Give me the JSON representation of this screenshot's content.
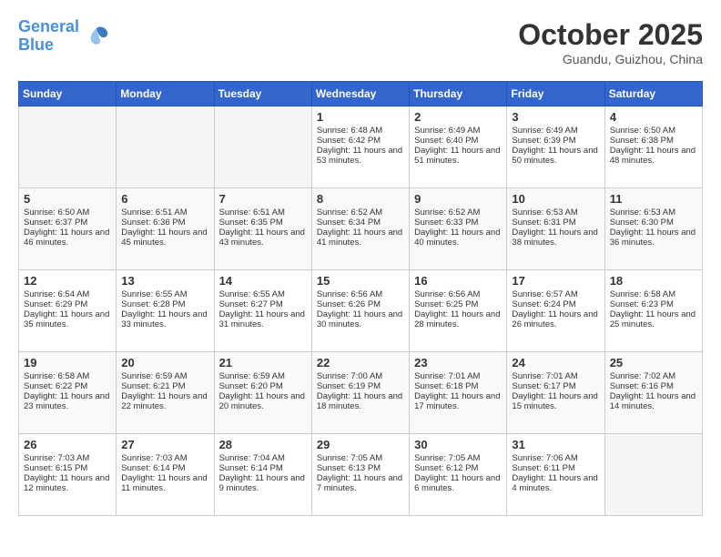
{
  "header": {
    "logo_line1": "General",
    "logo_line2": "Blue",
    "month": "October 2025",
    "location": "Guandu, Guizhou, China"
  },
  "weekdays": [
    "Sunday",
    "Monday",
    "Tuesday",
    "Wednesday",
    "Thursday",
    "Friday",
    "Saturday"
  ],
  "weeks": [
    [
      {
        "day": "",
        "info": ""
      },
      {
        "day": "",
        "info": ""
      },
      {
        "day": "",
        "info": ""
      },
      {
        "day": "1",
        "info": "Sunrise: 6:48 AM\nSunset: 6:42 PM\nDaylight: 11 hours and 53 minutes."
      },
      {
        "day": "2",
        "info": "Sunrise: 6:49 AM\nSunset: 6:40 PM\nDaylight: 11 hours and 51 minutes."
      },
      {
        "day": "3",
        "info": "Sunrise: 6:49 AM\nSunset: 6:39 PM\nDaylight: 11 hours and 50 minutes."
      },
      {
        "day": "4",
        "info": "Sunrise: 6:50 AM\nSunset: 6:38 PM\nDaylight: 11 hours and 48 minutes."
      }
    ],
    [
      {
        "day": "5",
        "info": "Sunrise: 6:50 AM\nSunset: 6:37 PM\nDaylight: 11 hours and 46 minutes."
      },
      {
        "day": "6",
        "info": "Sunrise: 6:51 AM\nSunset: 6:36 PM\nDaylight: 11 hours and 45 minutes."
      },
      {
        "day": "7",
        "info": "Sunrise: 6:51 AM\nSunset: 6:35 PM\nDaylight: 11 hours and 43 minutes."
      },
      {
        "day": "8",
        "info": "Sunrise: 6:52 AM\nSunset: 6:34 PM\nDaylight: 11 hours and 41 minutes."
      },
      {
        "day": "9",
        "info": "Sunrise: 6:52 AM\nSunset: 6:33 PM\nDaylight: 11 hours and 40 minutes."
      },
      {
        "day": "10",
        "info": "Sunrise: 6:53 AM\nSunset: 6:31 PM\nDaylight: 11 hours and 38 minutes."
      },
      {
        "day": "11",
        "info": "Sunrise: 6:53 AM\nSunset: 6:30 PM\nDaylight: 11 hours and 36 minutes."
      }
    ],
    [
      {
        "day": "12",
        "info": "Sunrise: 6:54 AM\nSunset: 6:29 PM\nDaylight: 11 hours and 35 minutes."
      },
      {
        "day": "13",
        "info": "Sunrise: 6:55 AM\nSunset: 6:28 PM\nDaylight: 11 hours and 33 minutes."
      },
      {
        "day": "14",
        "info": "Sunrise: 6:55 AM\nSunset: 6:27 PM\nDaylight: 11 hours and 31 minutes."
      },
      {
        "day": "15",
        "info": "Sunrise: 6:56 AM\nSunset: 6:26 PM\nDaylight: 11 hours and 30 minutes."
      },
      {
        "day": "16",
        "info": "Sunrise: 6:56 AM\nSunset: 6:25 PM\nDaylight: 11 hours and 28 minutes."
      },
      {
        "day": "17",
        "info": "Sunrise: 6:57 AM\nSunset: 6:24 PM\nDaylight: 11 hours and 26 minutes."
      },
      {
        "day": "18",
        "info": "Sunrise: 6:58 AM\nSunset: 6:23 PM\nDaylight: 11 hours and 25 minutes."
      }
    ],
    [
      {
        "day": "19",
        "info": "Sunrise: 6:58 AM\nSunset: 6:22 PM\nDaylight: 11 hours and 23 minutes."
      },
      {
        "day": "20",
        "info": "Sunrise: 6:59 AM\nSunset: 6:21 PM\nDaylight: 11 hours and 22 minutes."
      },
      {
        "day": "21",
        "info": "Sunrise: 6:59 AM\nSunset: 6:20 PM\nDaylight: 11 hours and 20 minutes."
      },
      {
        "day": "22",
        "info": "Sunrise: 7:00 AM\nSunset: 6:19 PM\nDaylight: 11 hours and 18 minutes."
      },
      {
        "day": "23",
        "info": "Sunrise: 7:01 AM\nSunset: 6:18 PM\nDaylight: 11 hours and 17 minutes."
      },
      {
        "day": "24",
        "info": "Sunrise: 7:01 AM\nSunset: 6:17 PM\nDaylight: 11 hours and 15 minutes."
      },
      {
        "day": "25",
        "info": "Sunrise: 7:02 AM\nSunset: 6:16 PM\nDaylight: 11 hours and 14 minutes."
      }
    ],
    [
      {
        "day": "26",
        "info": "Sunrise: 7:03 AM\nSunset: 6:15 PM\nDaylight: 11 hours and 12 minutes."
      },
      {
        "day": "27",
        "info": "Sunrise: 7:03 AM\nSunset: 6:14 PM\nDaylight: 11 hours and 11 minutes."
      },
      {
        "day": "28",
        "info": "Sunrise: 7:04 AM\nSunset: 6:14 PM\nDaylight: 11 hours and 9 minutes."
      },
      {
        "day": "29",
        "info": "Sunrise: 7:05 AM\nSunset: 6:13 PM\nDaylight: 11 hours and 7 minutes."
      },
      {
        "day": "30",
        "info": "Sunrise: 7:05 AM\nSunset: 6:12 PM\nDaylight: 11 hours and 6 minutes."
      },
      {
        "day": "31",
        "info": "Sunrise: 7:06 AM\nSunset: 6:11 PM\nDaylight: 11 hours and 4 minutes."
      },
      {
        "day": "",
        "info": ""
      }
    ]
  ]
}
